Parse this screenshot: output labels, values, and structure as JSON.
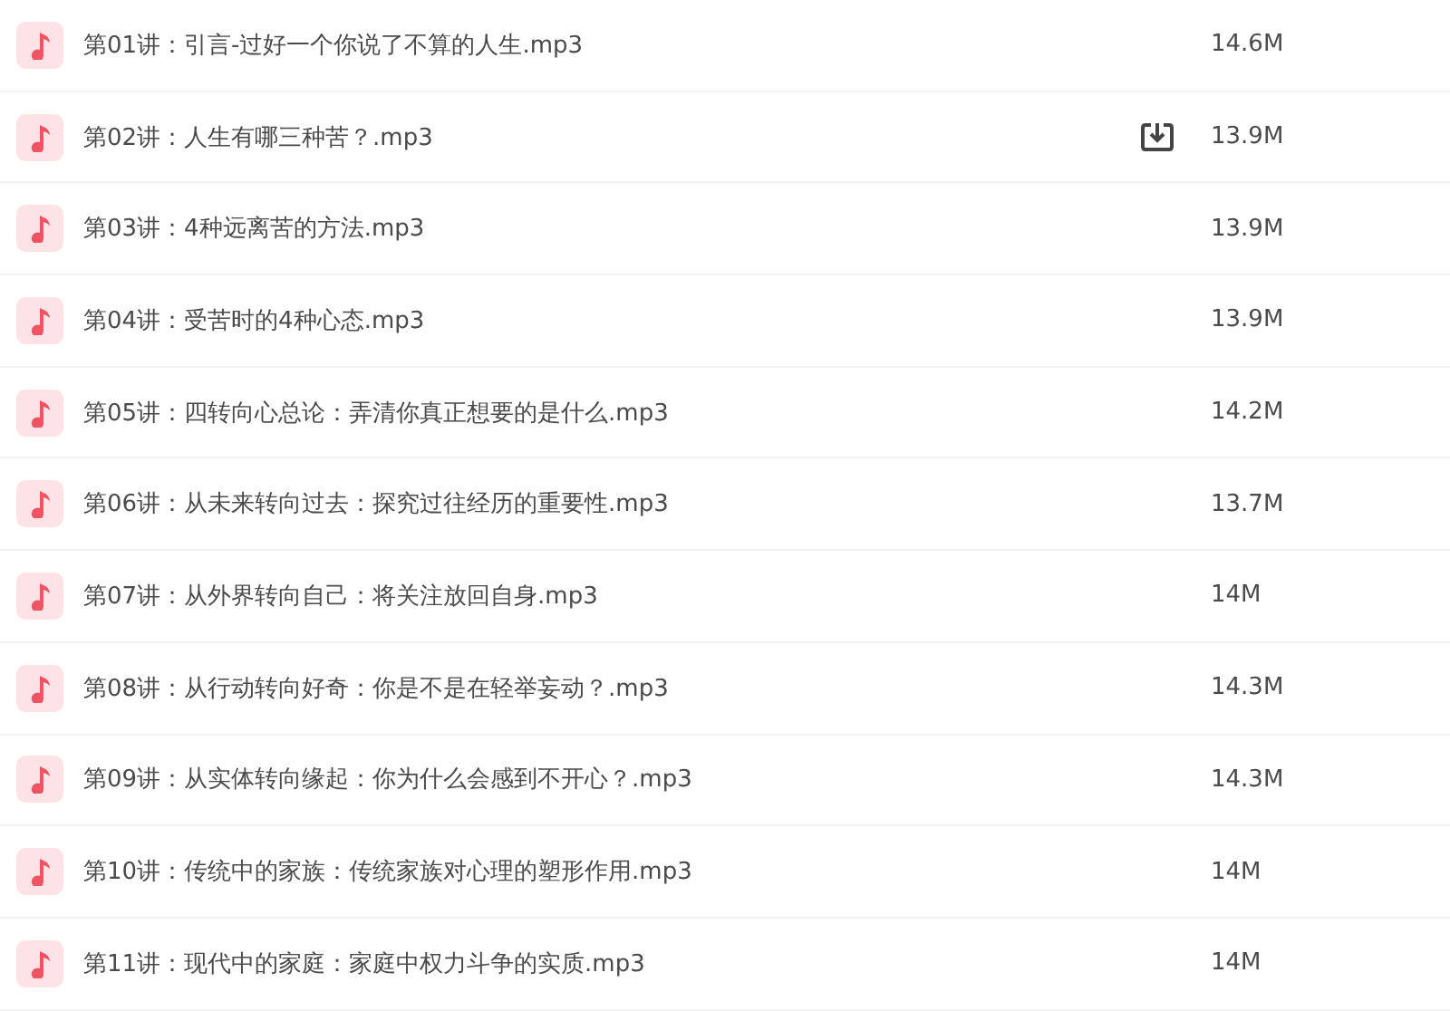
{
  "files": [
    {
      "name": "第01讲：引言-过好一个你说了不算的人生.mp3",
      "size": "14.6M",
      "hovered": false
    },
    {
      "name": "第02讲：人生有哪三种苦？.mp3",
      "size": "13.9M",
      "hovered": true
    },
    {
      "name": "第03讲：4种远离苦的方法.mp3",
      "size": "13.9M",
      "hovered": false
    },
    {
      "name": "第04讲：受苦时的4种心态.mp3",
      "size": "13.9M",
      "hovered": false
    },
    {
      "name": "第05讲：四转向心总论：弄清你真正想要的是什么.mp3",
      "size": "14.2M",
      "hovered": false
    },
    {
      "name": "第06讲：从未来转向过去：探究过往经历的重要性.mp3",
      "size": "13.7M",
      "hovered": false
    },
    {
      "name": "第07讲：从外界转向自己：将关注放回自身.mp3",
      "size": "14M",
      "hovered": false
    },
    {
      "name": "第08讲：从行动转向好奇：你是不是在轻举妄动？.mp3",
      "size": "14.3M",
      "hovered": false
    },
    {
      "name": "第09讲：从实体转向缘起：你为什么会感到不开心？.mp3",
      "size": "14.3M",
      "hovered": false
    },
    {
      "name": "第10讲：传统中的家族：传统家族对心理的塑形作用.mp3",
      "size": "14M",
      "hovered": false
    },
    {
      "name": "第11讲：现代中的家庭：家庭中权力斗争的实质.mp3",
      "size": "14M",
      "hovered": false
    }
  ]
}
